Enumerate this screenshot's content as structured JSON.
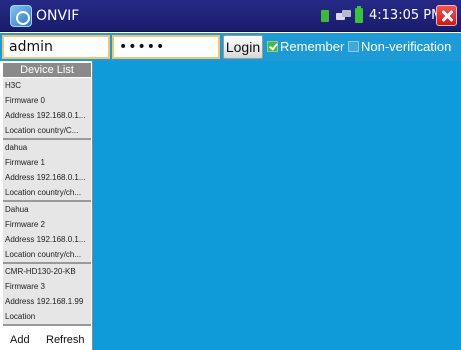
{
  "app": {
    "title": "ONVIF",
    "clock": "4:13:05 PM",
    "icons": {
      "app": "onvif-app-icon",
      "sd_card": "sd-card-icon",
      "network": "network-icon",
      "battery": "battery-icon",
      "close": "close-icon"
    }
  },
  "login": {
    "username": "admin",
    "password_masked": "•••••",
    "login_label": "Login",
    "remember_label": "Remember",
    "remember_checked": true,
    "nonverification_label": "Non-verification",
    "nonverification_checked": false
  },
  "device_list": {
    "header": "Device List",
    "devices": [
      {
        "name": "H3C",
        "firmware": "Firmware 0",
        "address": "Address 192.168.0.1...",
        "location": "Location country/C..."
      },
      {
        "name": "dahua",
        "firmware": "Firmware 1",
        "address": "Address 192.168.0.1...",
        "location": "Location country/ch..."
      },
      {
        "name": "Dahua",
        "firmware": "Firmware 2",
        "address": "Address 192.168.0.1...",
        "location": "Location country/ch..."
      },
      {
        "name": "CMR-HD130-20-KB",
        "firmware": "Firmware 3",
        "address": "Address 192.168.1.99",
        "location": "Location"
      }
    ],
    "add_label": "Add",
    "refresh_label": "Refresh"
  },
  "colors": {
    "titlebar": "#1f2278",
    "login_bar": "#1e9bd6",
    "main_area": "#0f9ad9",
    "list_item_bg": "#e6e6e6",
    "close_button": "#d92a2a"
  }
}
